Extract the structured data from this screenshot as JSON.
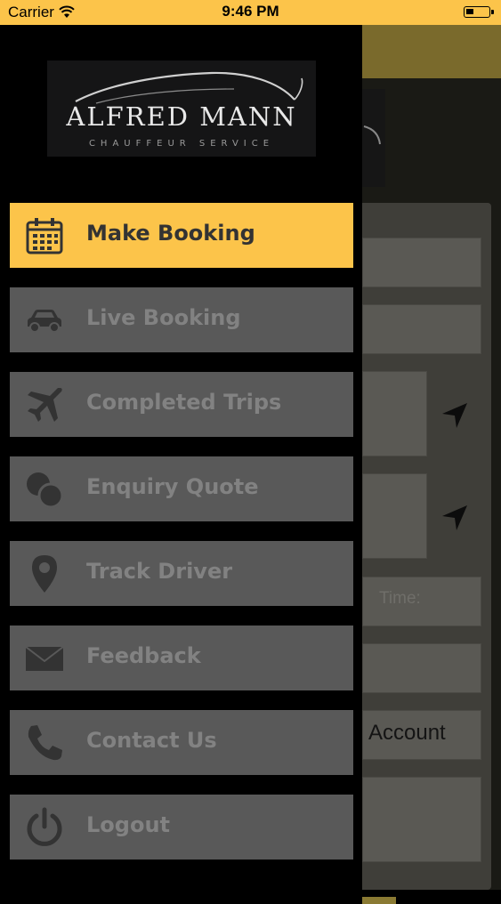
{
  "status_bar": {
    "carrier": "Carrier",
    "time": "9:46 PM"
  },
  "brand": {
    "name": "ALFRED MANN",
    "tagline": "CHAUFFEUR SERVICE"
  },
  "colors": {
    "accent": "#fcc44a",
    "menu_bg": "#595959",
    "menu_text": "#828282"
  },
  "menu": {
    "items": [
      {
        "label": "Make Booking",
        "icon": "calendar-icon",
        "active": true
      },
      {
        "label": "Live Booking",
        "icon": "car-icon",
        "active": false
      },
      {
        "label": "Completed Trips",
        "icon": "airplane-icon",
        "active": false
      },
      {
        "label": "Enquiry Quote",
        "icon": "chat-bubbles-icon",
        "active": false
      },
      {
        "label": "Track Driver",
        "icon": "location-pin-icon",
        "active": false
      },
      {
        "label": "Feedback",
        "icon": "envelope-icon",
        "active": false
      },
      {
        "label": "Contact Us",
        "icon": "phone-icon",
        "active": false
      },
      {
        "label": "Logout",
        "icon": "power-icon",
        "active": false
      }
    ]
  },
  "background_form": {
    "time_placeholder": "Time:",
    "account_label": "Account"
  }
}
